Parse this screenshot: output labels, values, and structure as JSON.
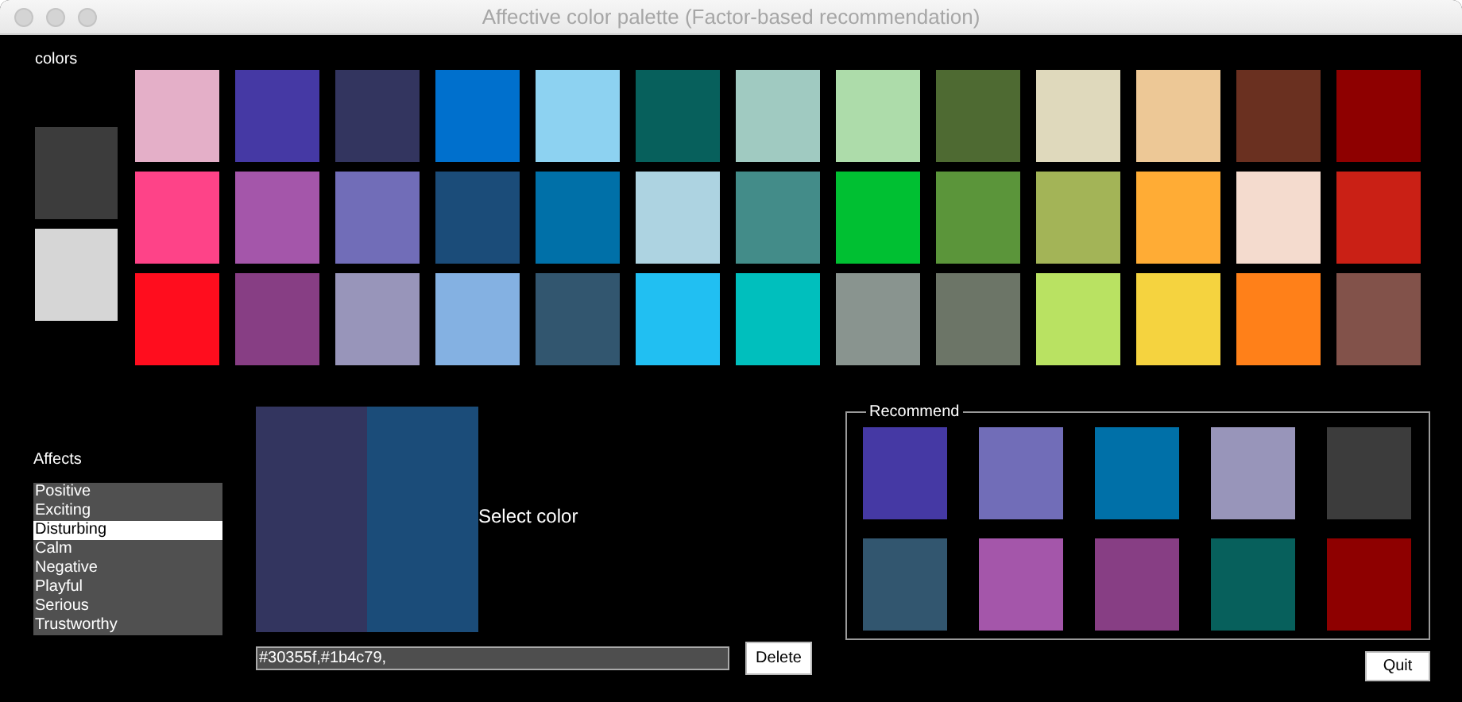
{
  "window": {
    "title": "Affective color palette (Factor-based recommendation)"
  },
  "colors": {
    "label": "colors",
    "current": [
      {
        "color": "#3c3c3c"
      },
      {
        "color": "#d6d6d6"
      }
    ],
    "palette": [
      [
        {
          "color": "#e4afc8"
        },
        {
          "color": "#4539a4"
        },
        {
          "color": "#33355f"
        },
        {
          "color": "#0070cd"
        },
        {
          "color": "#8dd2f1"
        },
        {
          "color": "#07605c"
        },
        {
          "color": "#a0cac1"
        },
        {
          "color": "#addcaa"
        },
        {
          "color": "#4e6a32"
        },
        {
          "color": "#dfd9bc"
        },
        {
          "color": "#edc896"
        },
        {
          "color": "#6a3020"
        },
        {
          "color": "#8e0000"
        }
      ],
      [
        {
          "color": "#fe4388"
        },
        {
          "color": "#a456aa"
        },
        {
          "color": "#716db8"
        },
        {
          "color": "#1b4c79"
        },
        {
          "color": "#0070a8"
        },
        {
          "color": "#add3e1"
        },
        {
          "color": "#438c89"
        },
        {
          "color": "#00c032"
        },
        {
          "color": "#5b953a"
        },
        {
          "color": "#a3b457"
        },
        {
          "color": "#ffac35"
        },
        {
          "color": "#f4dbce"
        },
        {
          "color": "#ca2015"
        }
      ],
      [
        {
          "color": "#ff0d1e"
        },
        {
          "color": "#873e84"
        },
        {
          "color": "#9895ba"
        },
        {
          "color": "#84b1e2"
        },
        {
          "color": "#32566f"
        },
        {
          "color": "#21bff2"
        },
        {
          "color": "#00bfbd"
        },
        {
          "color": "#89948f"
        },
        {
          "color": "#6c7567"
        },
        {
          "color": "#b9e262"
        },
        {
          "color": "#f5d33f"
        },
        {
          "color": "#ff8019"
        },
        {
          "color": "#82524a"
        }
      ]
    ]
  },
  "affects": {
    "label": "Affects",
    "items": [
      {
        "label": "Positive",
        "selected": false
      },
      {
        "label": "Exciting",
        "selected": false
      },
      {
        "label": "Disturbing",
        "selected": true
      },
      {
        "label": "Calm",
        "selected": false
      },
      {
        "label": "Negative",
        "selected": false
      },
      {
        "label": "Playful",
        "selected": false
      },
      {
        "label": "Serious",
        "selected": false
      },
      {
        "label": "Trustworthy",
        "selected": false
      }
    ]
  },
  "selection": {
    "preview": [
      {
        "color": "#33355f"
      },
      {
        "color": "#1b4c79"
      }
    ],
    "prompt": "Select color",
    "value": "#30355f,#1b4c79,",
    "delete": "Delete"
  },
  "recommend": {
    "title": "Recommend",
    "colors": [
      {
        "color": "#4539a4"
      },
      {
        "color": "#716db8"
      },
      {
        "color": "#0070a8"
      },
      {
        "color": "#9895ba"
      },
      {
        "color": "#3c3c3c"
      },
      {
        "color": "#32566f"
      },
      {
        "color": "#a456aa"
      },
      {
        "color": "#873e84"
      },
      {
        "color": "#07605c"
      },
      {
        "color": "#8e0000"
      }
    ]
  },
  "quit": "Quit"
}
